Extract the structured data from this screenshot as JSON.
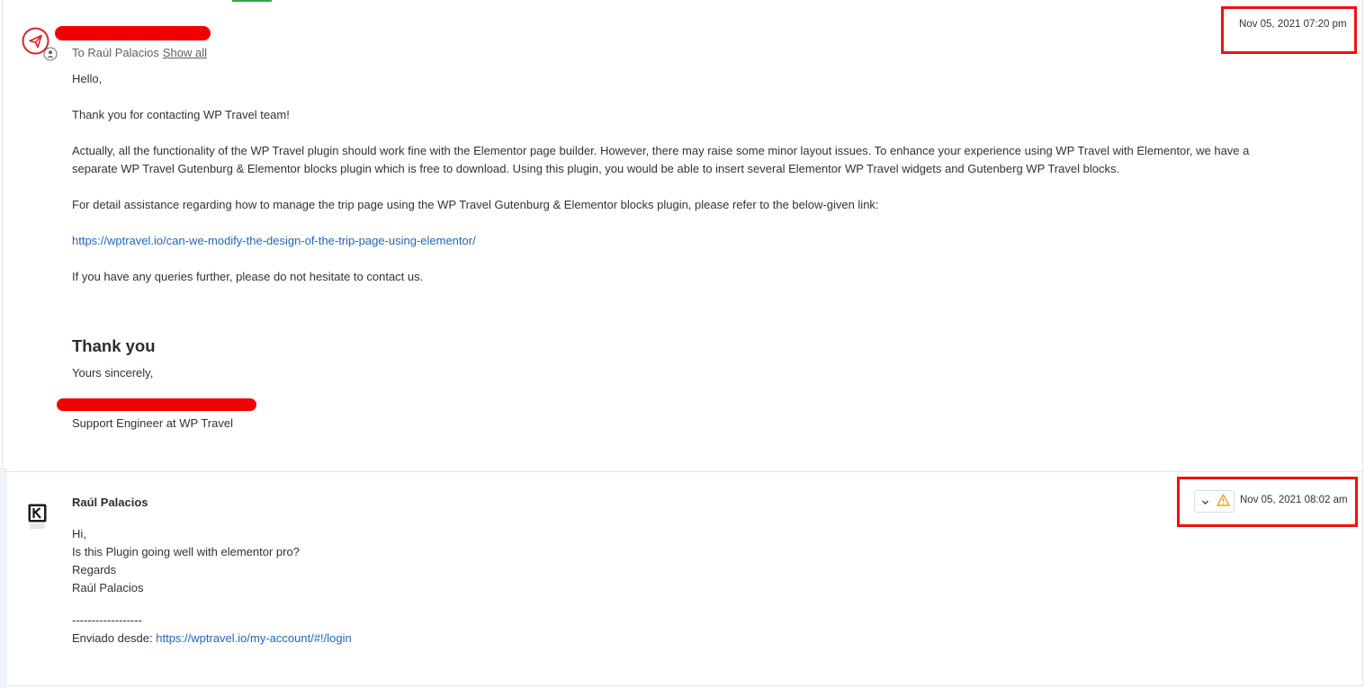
{
  "message1": {
    "to_prefix": "To",
    "recipient": "Raúl Palacios",
    "show_all": "Show all",
    "timestamp": "Nov 05, 2021 07:20 pm",
    "greeting": "Hello,",
    "p1": "Thank you for contacting WP Travel team!",
    "p2_line1": "Actually, all the functionality of the WP Travel plugin should work fine with the Elementor page builder. However, there may raise some minor layout issues. To enhance your experience using WP Travel with Elementor, we have a",
    "p2_line2": "separate WP Travel Gutenburg & Elementor blocks plugin which is free to download. Using this plugin, you would be able to insert several Elementor WP Travel widgets and Gutenberg WP Travel blocks.",
    "p3": "For detail assistance regarding how to manage the trip page using the WP Travel Gutenburg & Elementor blocks plugin, please refer to the below-given link:",
    "link": "https://wptravel.io/can-we-modify-the-design-of-the-trip-page-using-elementor/",
    "p4": "If you have any queries further, please do not hesitate to contact us.",
    "heading": "Thank you",
    "closing": "Yours sincerely,",
    "signature_title": "Support Engineer at WP Travel"
  },
  "message2": {
    "sender": "Raúl Palacios",
    "timestamp": "Nov 05, 2021 08:02 am",
    "line1": "Hi,",
    "line2": "Is this Plugin going well with elementor pro?",
    "line3": "Regards",
    "line4": "Raúl Palacios",
    "separator": "------------------",
    "sent_from_label": "Enviado desde:",
    "sent_from_link": "https://wptravel.io/my-account/#!/login"
  },
  "icons": {
    "agent_avatar": "paper-plane-icon",
    "agent_badge": "user-icon",
    "customer_avatar": "k-logo-icon",
    "dropdown": "chevron-down-icon",
    "warning": "warning-icon"
  },
  "colors": {
    "accent_red": "#d9252a",
    "link_blue": "#2466b8",
    "warning_orange": "#f0a020",
    "highlight_red": "#ee1111"
  }
}
